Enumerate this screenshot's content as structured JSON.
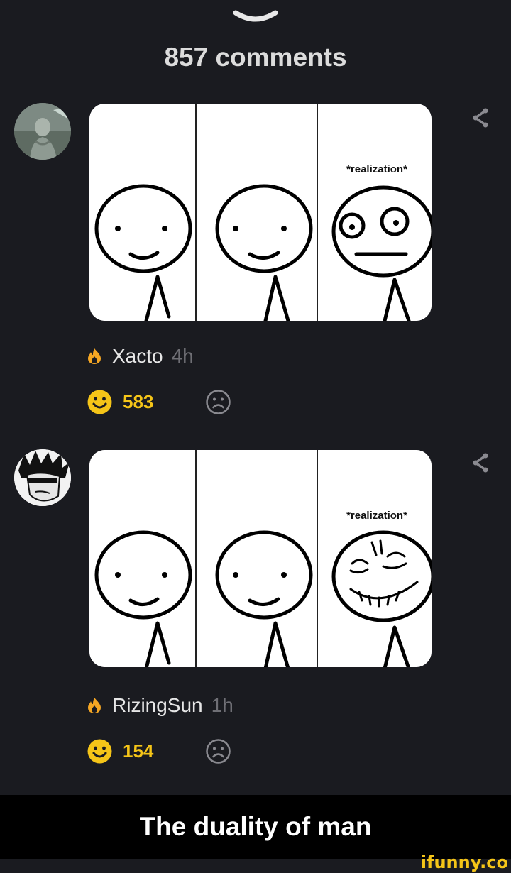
{
  "header": {
    "comments_count": "857 comments"
  },
  "comments": [
    {
      "username": "Xacto",
      "time": "4h",
      "upvotes": "583",
      "comic_caption": "*realization*",
      "avatar_icon": "statue-avatar",
      "rank_icon": "flame-icon"
    },
    {
      "username": "RizingSun",
      "time": "1h",
      "upvotes": "154",
      "comic_caption": "*realization*",
      "avatar_icon": "anime-avatar",
      "rank_icon": "flame-icon"
    }
  ],
  "caption": "The duality of man",
  "watermark": "ifunny.co",
  "colors": {
    "background": "#1a1b20",
    "accent": "#f5c518",
    "flame": "#f5a623",
    "muted": "#6f6f75"
  }
}
